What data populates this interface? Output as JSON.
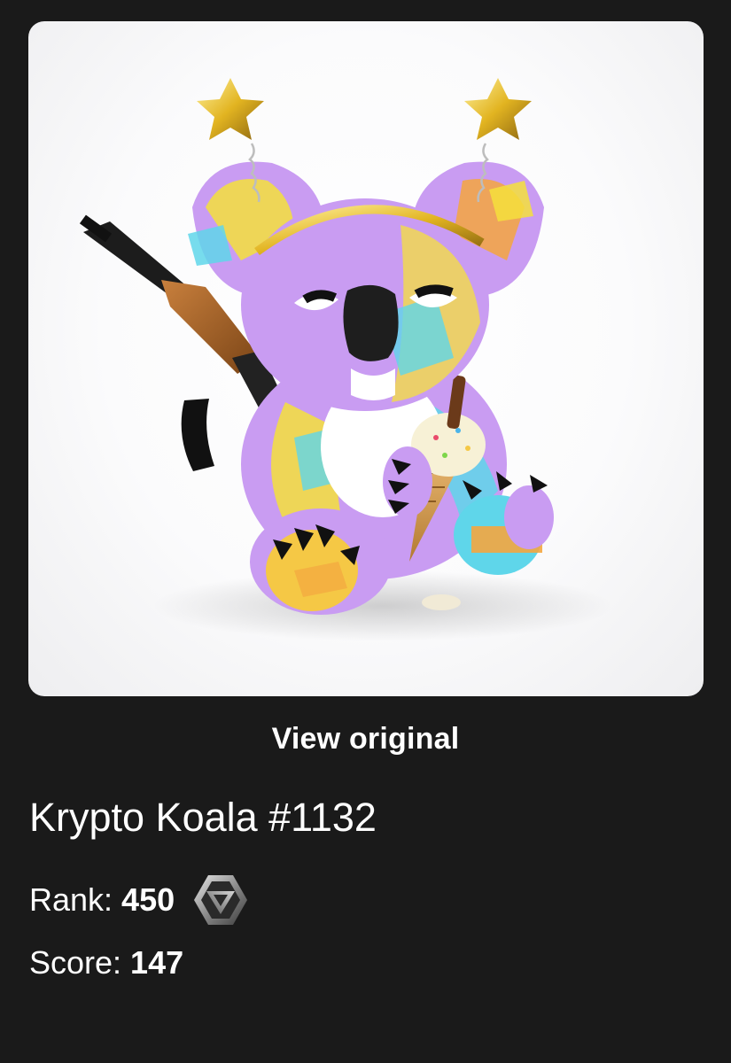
{
  "nft": {
    "title": "Krypto Koala #1132",
    "view_original_label": "View original",
    "rank_label": "Rank:",
    "rank_value": "450",
    "score_label": "Score:",
    "score_value": "147",
    "rank_badge_icon": "silver-hexagon-badge-icon",
    "image_subject": "koala-figurine-image"
  },
  "colors": {
    "background": "#1a1a1a",
    "text": "#ffffff",
    "koala_purple": "#c99cf2",
    "accent_yellow": "#f5e03c",
    "accent_cyan": "#5fd6ea",
    "accent_orange": "#f4a640",
    "star_gold": "#e2b421"
  }
}
